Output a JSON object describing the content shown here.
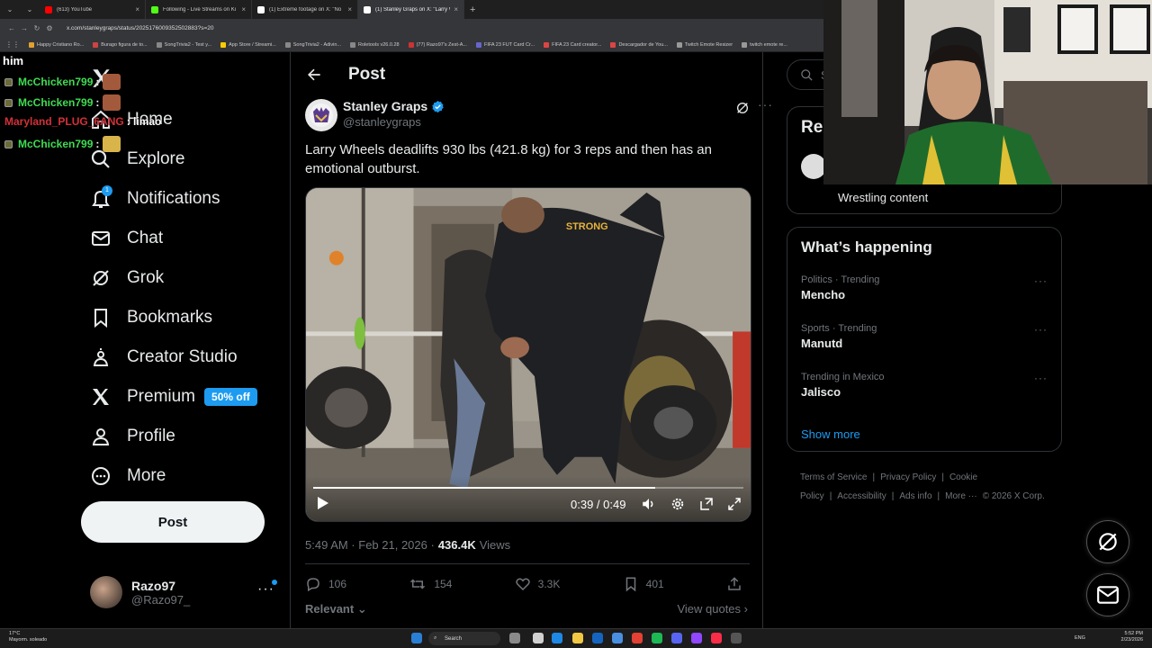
{
  "browser": {
    "tabs": [
      {
        "title": "(613) YouTube",
        "color": "#ff0000",
        "active": false
      },
      {
        "title": "Following - Live Streams on Ki",
        "color": "#53fc18",
        "active": false
      },
      {
        "title": "(1) Extreme footage on X: \"No",
        "color": "#ffffff",
        "active": false
      },
      {
        "title": "(1) Stanley Graps on X: \"Larry W",
        "color": "#ffffff",
        "active": true
      }
    ],
    "url": "x.com/stanleygraps/status/2025176009352502883?s=20",
    "bookmarks": [
      {
        "label": "Happy Cristiano Ro...",
        "color": "#e0a030"
      },
      {
        "label": "Burago figura de to...",
        "color": "#cc4444"
      },
      {
        "label": "SongTrivia2 - Test y...",
        "color": "#888888"
      },
      {
        "label": "App Store / Streami...",
        "color": "#ffcc00"
      },
      {
        "label": "SongTrivia2 - Adivin...",
        "color": "#888888"
      },
      {
        "label": "Roletools v26.0.28",
        "color": "#888888"
      },
      {
        "label": "(77) Razo97's Zest-A...",
        "color": "#cc3333"
      },
      {
        "label": "FIFA 23 FUT Card Cr...",
        "color": "#6666cc"
      },
      {
        "label": "FIFA 23 Card creator...",
        "color": "#dd4444"
      },
      {
        "label": "Descargador de You...",
        "color": "#dd4444"
      },
      {
        "label": "Twitch Emote Resizer",
        "color": "#999999"
      },
      {
        "label": "twitch emote re...",
        "color": "#999999"
      }
    ]
  },
  "chat": {
    "header": "him",
    "lines": [
      {
        "user": "McChicken799",
        "text": ":",
        "color": "#3fdc52",
        "emote_color": "#a35a3c"
      },
      {
        "user": "McChicken799",
        "text": ":",
        "color": "#3fdc52",
        "emote_color": "#a35a3c"
      },
      {
        "user": "Maryland_PLUG_6ANG",
        "text": ": limao",
        "color": "#d43039",
        "emote_color": ""
      },
      {
        "user": "McChicken799",
        "text": ":",
        "color": "#3fdc52",
        "emote_color": "#d8b44a"
      }
    ]
  },
  "sidebar": {
    "items": [
      {
        "name": "home",
        "label": "Home",
        "icon": "home-icon"
      },
      {
        "name": "explore",
        "label": "Explore",
        "icon": "search-icon"
      },
      {
        "name": "notifications",
        "label": "Notifications",
        "icon": "bell-icon",
        "badge": "1"
      },
      {
        "name": "chat",
        "label": "Chat",
        "icon": "mail-icon"
      },
      {
        "name": "grok",
        "label": "Grok",
        "icon": "grok-icon"
      },
      {
        "name": "bookmarks",
        "label": "Bookmarks",
        "icon": "bookmark-icon"
      },
      {
        "name": "creator-studio",
        "label": "Creator Studio",
        "icon": "creator-icon"
      },
      {
        "name": "premium",
        "label": "Premium",
        "icon": "x-icon",
        "promo": "50% off"
      },
      {
        "name": "profile",
        "label": "Profile",
        "icon": "person-icon"
      },
      {
        "name": "more",
        "label": "More",
        "icon": "more-circle-icon"
      }
    ],
    "post_button": "Post",
    "account": {
      "name": "Razo97",
      "handle": "@Razo97_"
    }
  },
  "main": {
    "header_title": "Post",
    "author": {
      "name": "Stanley Graps",
      "handle": "@stanleygraps"
    },
    "text": "Larry Wheels deadlifts 930 lbs (421.8 kg) for 3 reps and then has an emotional outburst.",
    "video": {
      "time": "0:39 / 0:49",
      "progress": 0.7959,
      "shirt_text": "STRONG"
    },
    "posted_at": "5:49 AM · Feb 21, 2026 · ",
    "views_count": "436.4K",
    "views_label": "Views",
    "actions": {
      "replies": "106",
      "reposts": "154",
      "likes": "3.3K",
      "bookmarks": "401"
    },
    "relevant_label": "Relevant",
    "view_quotes_label": "View quotes"
  },
  "right": {
    "search_placeholder": "Se",
    "relevant_title": "Rel",
    "relevant_desc": "Wrestling content",
    "whats_happening_title": "What’s happening",
    "trends": [
      {
        "context": "Politics · Trending",
        "name": "Mencho"
      },
      {
        "context": "Sports · Trending",
        "name": "Manutd"
      },
      {
        "context": "Trending in Mexico",
        "name": "Jalisco"
      }
    ],
    "show_more": "Show more",
    "footer": [
      "Terms of Service",
      "|",
      "Privacy Policy",
      "|",
      "Cookie Policy",
      "|",
      "Accessibility",
      "|",
      "Ads info",
      "|",
      "More ···",
      "© 2026 X Corp."
    ]
  },
  "taskbar": {
    "weather_temp": "17°C",
    "weather_desc": "Mayorm. soleado",
    "search": "Search",
    "lang": "ENG",
    "time": "5:52 PM",
    "date": "2/23/2026"
  },
  "colors": {
    "accent": "#1d9bf0",
    "background": "#000000",
    "border": "#2f3336",
    "muted": "#71767b"
  }
}
